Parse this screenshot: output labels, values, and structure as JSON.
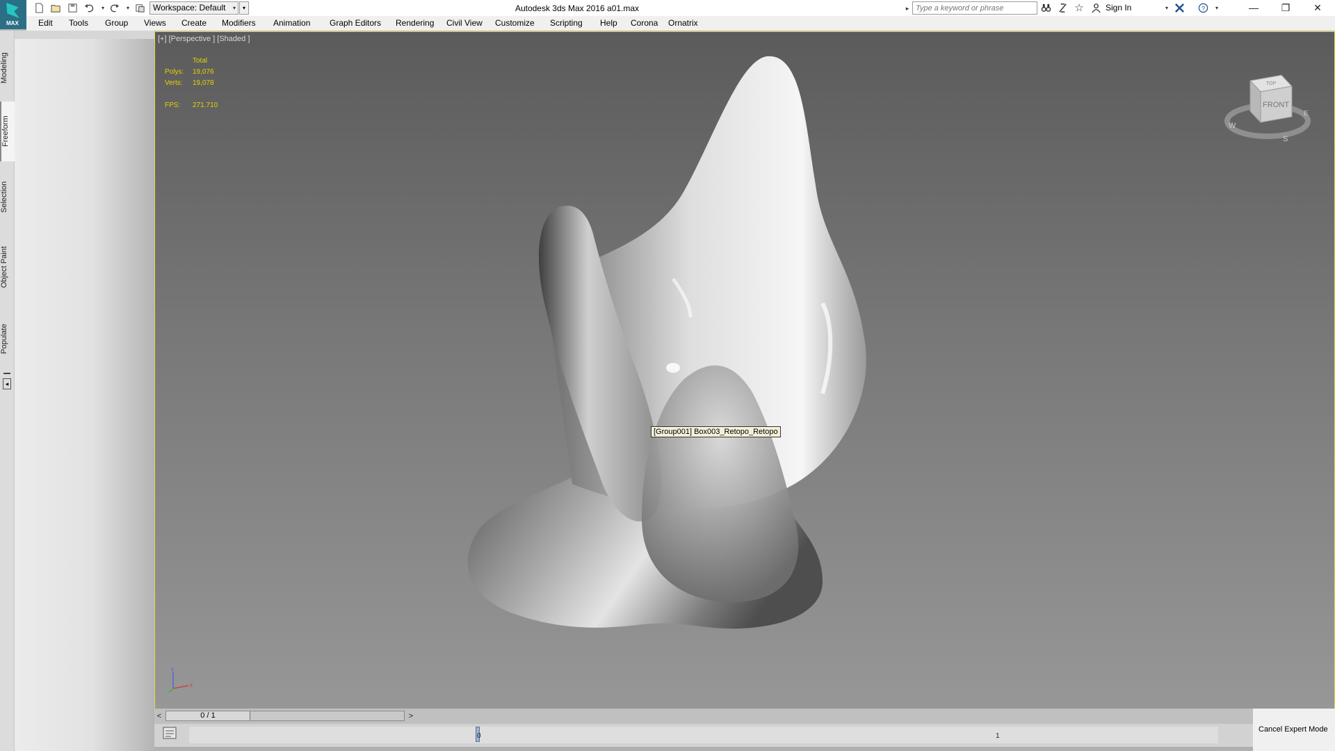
{
  "app": {
    "logo_text": "MAX",
    "window_title": "Autodesk 3ds Max 2016     a01.max",
    "workspace": "Workspace: Default",
    "search_placeholder": "Type a keyword or phrase",
    "sign_in": "Sign In",
    "window_buttons": {
      "minimize": "—",
      "restore": "❐",
      "close": "✕"
    }
  },
  "menu": [
    "Edit",
    "Tools",
    "Group",
    "Views",
    "Create",
    "Modifiers",
    "Animation",
    "Graph Editors",
    "Rendering",
    "Civil View",
    "Customize",
    "Scripting",
    "Help",
    "Corona",
    "Ornatrix"
  ],
  "ribbon_tabs": [
    "Modeling",
    "Freeform",
    "Selection",
    "Object Paint",
    "Populate"
  ],
  "viewport": {
    "label": "[+] [Perspective ] [Shaded ]",
    "stats": {
      "total_label": "Total",
      "polys_label": "Polys:",
      "polys_value": "19,076",
      "verts_label": "Verts:",
      "verts_value": "19,078",
      "fps_label": "FPS:",
      "fps_value": "271.710"
    },
    "tooltip": "[Group001] Box003_Retopo_Retopo",
    "viewcube": {
      "front": "FRONT",
      "top": "TOP",
      "west": "W",
      "south": "S",
      "east": "E"
    },
    "axis": {
      "z": "z",
      "x": "x"
    }
  },
  "timeline": {
    "prev": "<",
    "frame": "0 / 1",
    "next": ">",
    "tick_start": "0",
    "tick_end": "1"
  },
  "status": {
    "cancel_expert_mode": "Cancel Expert Mode"
  }
}
